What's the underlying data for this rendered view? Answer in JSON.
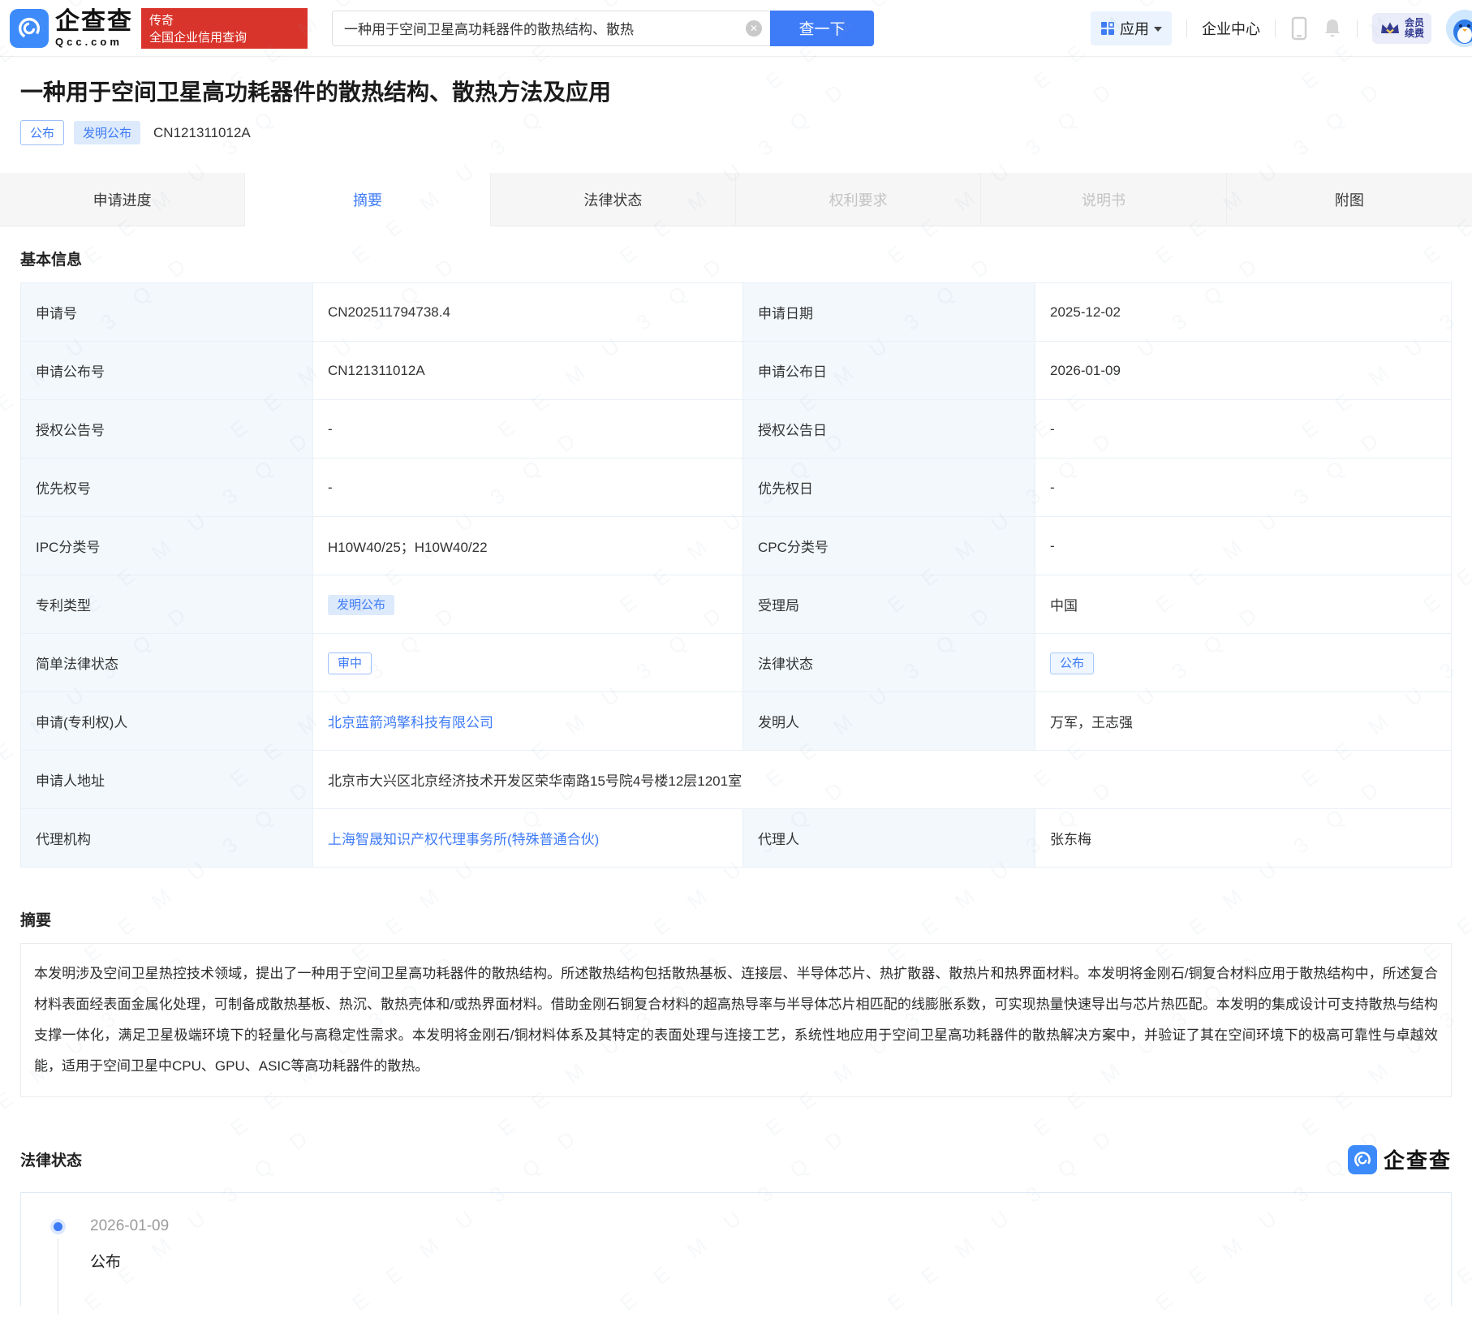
{
  "colors": {
    "accent": "#3e7bf7",
    "promo_red": "#d9342b",
    "label_bg": "#f2f8fc"
  },
  "watermark": "E E M U 3 Q D",
  "header": {
    "logo_title": "企查查",
    "logo_subtitle": "Qcc.com",
    "promo_line1": "传奇",
    "promo_line2": "全国企业信用查询",
    "search": {
      "value": "一种用于空间卫星高功耗器件的散热结构、散热",
      "button_label": "查一下"
    },
    "nav": {
      "apps_label": "应用",
      "enterprise_center_label": "企业中心",
      "vip_line1": "会员",
      "vip_line2": "续费"
    }
  },
  "patent": {
    "title": "一种用于空间卫星高功耗器件的散热结构、散热方法及应用",
    "status_badge": "公布",
    "type_badge": "发明公布",
    "publication_number": "CN121311012A"
  },
  "tabs": [
    {
      "label": "申请进度"
    },
    {
      "label": "摘要"
    },
    {
      "label": "法律状态"
    },
    {
      "label": "权利要求"
    },
    {
      "label": "说明书"
    },
    {
      "label": "附图"
    }
  ],
  "basic_info": {
    "heading": "基本信息",
    "rows": [
      {
        "l1": "申请号",
        "v1": "CN202511794738.4",
        "l2": "申请日期",
        "v2": "2025-12-02"
      },
      {
        "l1": "申请公布号",
        "v1": "CN121311012A",
        "l2": "申请公布日",
        "v2": "2026-01-09"
      },
      {
        "l1": "授权公告号",
        "v1": "-",
        "l2": "授权公告日",
        "v2": "-"
      },
      {
        "l1": "优先权号",
        "v1": "-",
        "l2": "优先权日",
        "v2": "-"
      },
      {
        "l1": "IPC分类号",
        "v1": "H10W40/25；H10W40/22",
        "l2": "CPC分类号",
        "v2": "-"
      },
      {
        "l1": "专利类型",
        "v1": "发明公布",
        "l2": "受理局",
        "v2": "中国"
      },
      {
        "l1": "简单法律状态",
        "v1": "审中",
        "l2": "法律状态",
        "v2": "公布"
      },
      {
        "l1": "申请(专利权)人",
        "v1": "北京蓝箭鸿擎科技有限公司",
        "l2": "发明人",
        "v2": "万军，王志强"
      },
      {
        "l1": "申请人地址",
        "v1": "北京市大兴区北京经济技术开发区荣华南路15号院4号楼12层1201室"
      },
      {
        "l1": "代理机构",
        "v1": "上海智晟知识产权代理事务所(特殊普通合伙)",
        "l2": "代理人",
        "v2": "张东梅"
      }
    ]
  },
  "abstract": {
    "heading": "摘要",
    "text": "本发明涉及空间卫星热控技术领域，提出了一种用于空间卫星高功耗器件的散热结构。所述散热结构包括散热基板、连接层、半导体芯片、热扩散器、散热片和热界面材料。本发明将金刚石/铜复合材料应用于散热结构中，所述复合材料表面经表面金属化处理，可制备成散热基板、热沉、散热壳体和/或热界面材料。借助金刚石铜复合材料的超高热导率与半导体芯片相匹配的线膨胀系数，可实现热量快速导出与芯片热匹配。本发明的集成设计可支持散热与结构支撑一体化，满足卫星极端环境下的轻量化与高稳定性需求。本发明将金刚石/铜材料体系及其特定的表面处理与连接工艺，系统性地应用于空间卫星高功耗器件的散热解决方案中，并验证了其在空间环境下的极高可靠性与卓越效能，适用于空间卫星中CPU、GPU、ASIC等高功耗器件的散热。"
  },
  "legal_status": {
    "heading": "法律状态",
    "brand_name": "企查查",
    "events": [
      {
        "date": "2026-01-09",
        "status": "公布"
      }
    ]
  }
}
